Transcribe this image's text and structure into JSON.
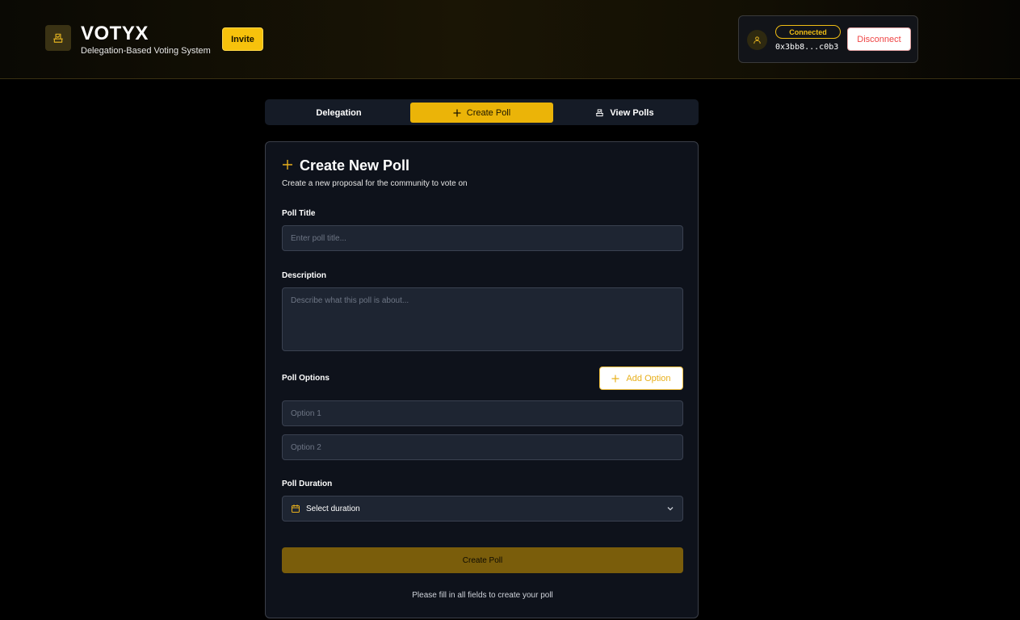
{
  "brand": {
    "name": "VOTYX",
    "tagline": "Delegation-Based Voting System",
    "invite_label": "Invite"
  },
  "wallet": {
    "status": "Connected",
    "address": "0x3bb8...c0b3",
    "disconnect_label": "Disconnect"
  },
  "tabs": [
    {
      "label": "Delegation",
      "icon": "none",
      "active": false
    },
    {
      "label": "Create Poll",
      "icon": "plus-icon",
      "active": true
    },
    {
      "label": "View Polls",
      "icon": "ballot-icon",
      "active": false
    }
  ],
  "form": {
    "title": "Create New Poll",
    "subtitle": "Create a new proposal for the community to vote on",
    "poll_title": {
      "label": "Poll Title",
      "placeholder": "Enter poll title...",
      "value": ""
    },
    "description": {
      "label": "Description",
      "placeholder": "Describe what this poll is about...",
      "value": ""
    },
    "options": {
      "label": "Poll Options",
      "add_label": "Add Option",
      "items": [
        {
          "placeholder": "Option 1",
          "value": ""
        },
        {
          "placeholder": "Option 2",
          "value": ""
        }
      ]
    },
    "duration": {
      "label": "Poll Duration",
      "selected": "Select duration"
    },
    "submit_label": "Create Poll",
    "hint": "Please fill in all fields to create your poll"
  },
  "colors": {
    "accent": "#ebb408",
    "background": "#000000",
    "card": "#0e121b",
    "field": "#1e2532",
    "danger": "#ef4444"
  }
}
